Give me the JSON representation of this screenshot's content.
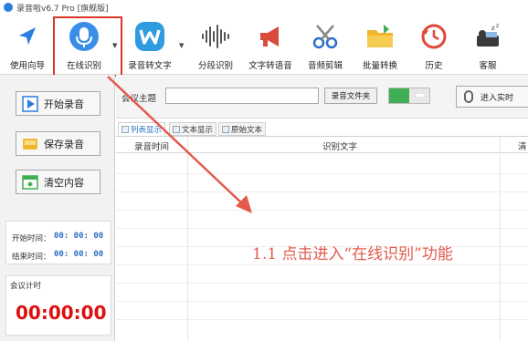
{
  "window": {
    "title": "录音啦v6.7 Pro [旗舰版]"
  },
  "toolbar": {
    "items": [
      {
        "label": "使用向导",
        "icon": "navigation-arrow-icon"
      },
      {
        "label": "在线识别",
        "icon": "microphone-icon"
      },
      {
        "label": "录音转文字",
        "icon": "w-badge-icon"
      },
      {
        "label": "分段识别",
        "icon": "waveform-icon"
      },
      {
        "label": "文字转语音",
        "icon": "megaphone-icon"
      },
      {
        "label": "音频剪辑",
        "icon": "scissors-icon"
      },
      {
        "label": "批量转换",
        "icon": "folder-icon"
      },
      {
        "label": "历史",
        "icon": "history-clock-icon"
      },
      {
        "label": "客服",
        "icon": "support-icon"
      }
    ],
    "dropdown_glyph": "▼"
  },
  "left_panel": {
    "start_label": "开始录音",
    "save_label": "保存录音",
    "clear_label": "清空内容",
    "start_time_label": "开始时间：",
    "start_time_value": "00: 00: 00",
    "end_time_label": "结束时间：",
    "end_time_value": "00: 00: 00",
    "meeting_timer_label": "会议计时",
    "meeting_timer_value": "00:00:00"
  },
  "topbar": {
    "topic_label": "会议主题",
    "topic_value": "",
    "folder_button": "录音文件夹",
    "realtime_button": "进入实时"
  },
  "tabs": [
    {
      "label": "列表显示",
      "active": true
    },
    {
      "label": "文本显示",
      "active": false
    },
    {
      "label": "原始文本",
      "active": false
    }
  ],
  "table": {
    "columns": [
      "录音时间",
      "识别文字",
      "清"
    ]
  },
  "annotation": {
    "text": "1.1 点击进入“在线识别”功能",
    "color": "#e25a4c"
  },
  "colors": {
    "highlight": "#d9352b",
    "timer": "#e01010",
    "time_value": "#2b6fc6",
    "toggle_on": "#3fae54"
  }
}
